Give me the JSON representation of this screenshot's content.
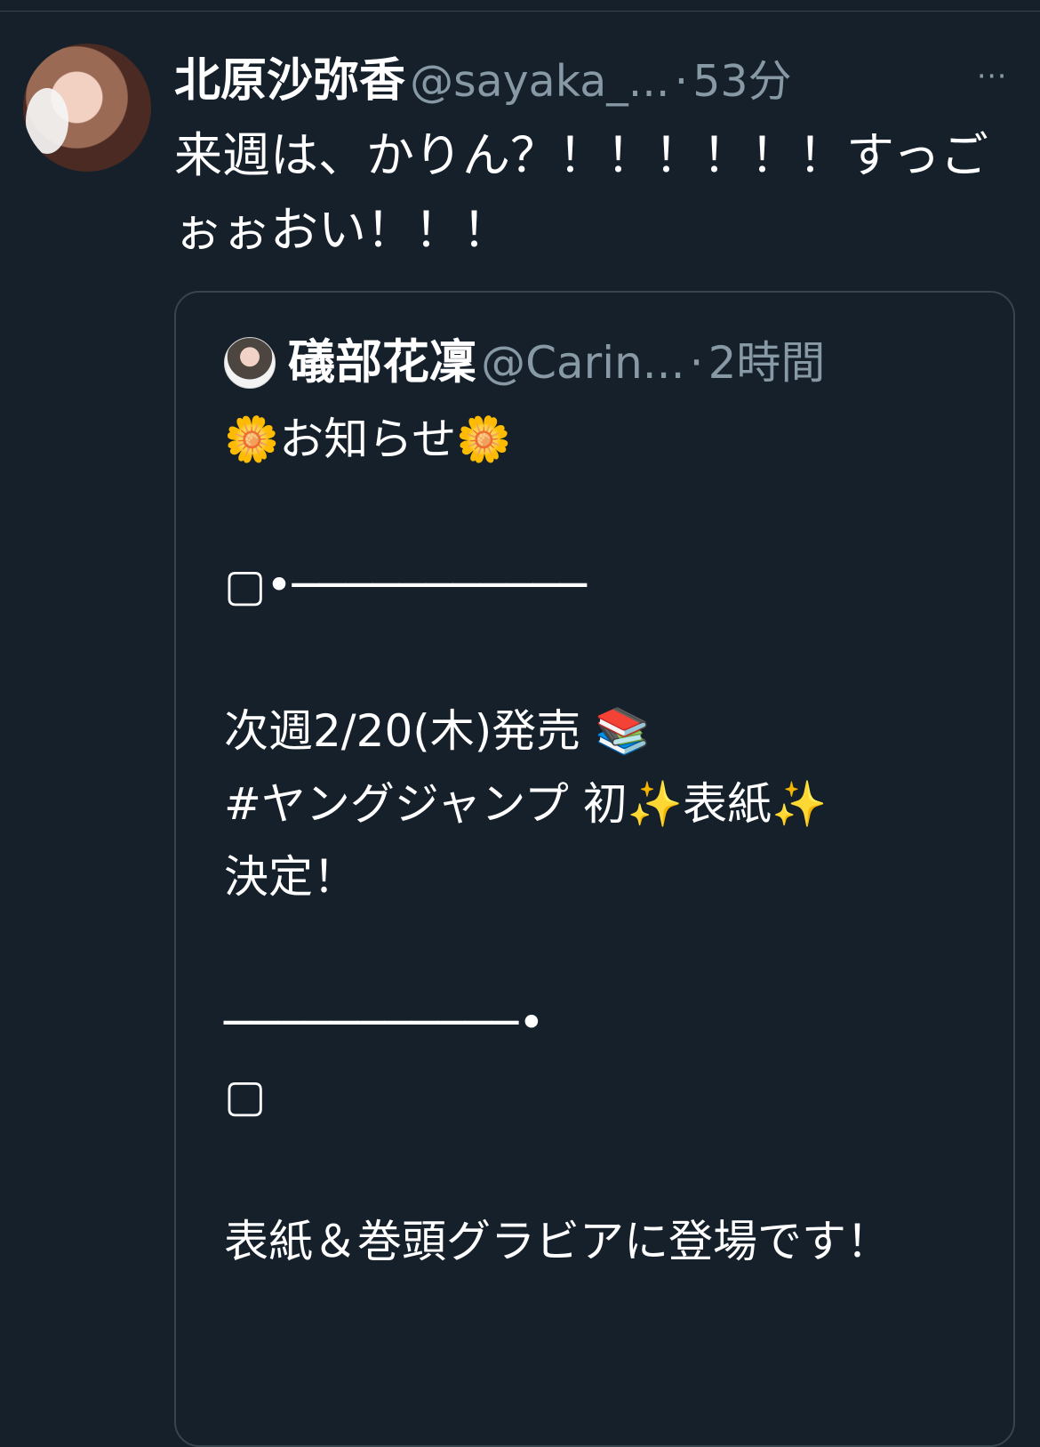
{
  "tweet": {
    "author_name": "北原沙弥香",
    "author_handle": "@sayaka_...",
    "separator": "·",
    "time": "53分",
    "more_icon": "⋯",
    "text": "来週は、かりん？！！！！！！すっごぉぉおい！！！"
  },
  "quote": {
    "author_name": "礒部花凜",
    "author_handle": "@Carin...",
    "separator": "·",
    "time": "2時間",
    "text": "🌼お知らせ🌼\n\n▢•───────────\n\n次週2/20(木)発売 📚\n#ヤングジャンプ 初✨表紙✨\n決定！\n\n───────────•\n▢\n\n表紙＆巻頭グラビアに登場です！"
  }
}
